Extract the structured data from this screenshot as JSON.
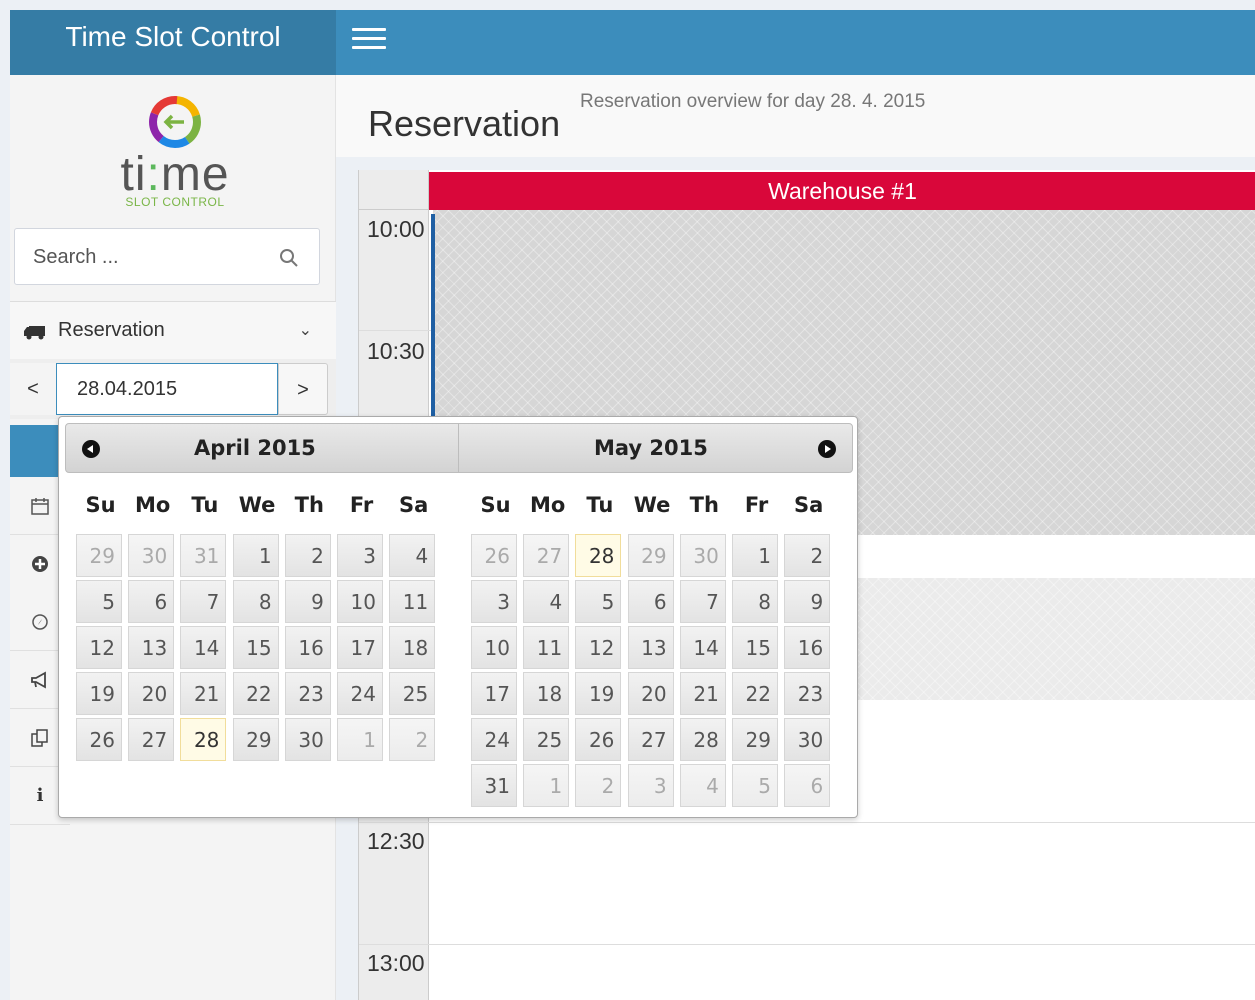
{
  "app": {
    "title": "Time Slot Control"
  },
  "logo": {
    "word_a": "ti",
    "word_b": "me",
    "subtitle": "SLOT CONTROL",
    "ring_colors": [
      "#e53935",
      "#f4b400",
      "#7cb342",
      "#1e88e5",
      "#8e24aa"
    ]
  },
  "search": {
    "placeholder": "Search ..."
  },
  "nav": {
    "reservation_label": "Reservation"
  },
  "date": {
    "prev": "<",
    "next": ">",
    "value": "28.04.2015"
  },
  "sidebar_icons": [
    "calendar-icon",
    "plus-circle-icon",
    "compass-icon",
    "bullhorn-icon",
    "copy-icon",
    "info-icon"
  ],
  "page": {
    "title": "Reservation",
    "subtitle": "Reservation overview for day 28. 4. 2015"
  },
  "schedule": {
    "warehouse": "Warehouse #1",
    "accent_color": "#d9073a",
    "slots": [
      "10:00",
      "10:30",
      "12:30",
      "13:00"
    ]
  },
  "datepicker": {
    "weekdays": [
      "Su",
      "Mo",
      "Tu",
      "We",
      "Th",
      "Fr",
      "Sa"
    ],
    "months": [
      {
        "title": "April 2015",
        "weeks": [
          [
            {
              "d": "29",
              "o": true
            },
            {
              "d": "30",
              "o": true
            },
            {
              "d": "31",
              "o": true
            },
            {
              "d": "1"
            },
            {
              "d": "2"
            },
            {
              "d": "3"
            },
            {
              "d": "4"
            }
          ],
          [
            {
              "d": "5"
            },
            {
              "d": "6"
            },
            {
              "d": "7"
            },
            {
              "d": "8"
            },
            {
              "d": "9"
            },
            {
              "d": "10"
            },
            {
              "d": "11"
            }
          ],
          [
            {
              "d": "12"
            },
            {
              "d": "13"
            },
            {
              "d": "14"
            },
            {
              "d": "15"
            },
            {
              "d": "16"
            },
            {
              "d": "17"
            },
            {
              "d": "18"
            }
          ],
          [
            {
              "d": "19"
            },
            {
              "d": "20"
            },
            {
              "d": "21"
            },
            {
              "d": "22"
            },
            {
              "d": "23"
            },
            {
              "d": "24"
            },
            {
              "d": "25"
            }
          ],
          [
            {
              "d": "26"
            },
            {
              "d": "27"
            },
            {
              "d": "28",
              "t": true
            },
            {
              "d": "29"
            },
            {
              "d": "30"
            },
            {
              "d": "1",
              "o": true
            },
            {
              "d": "2",
              "o": true
            }
          ]
        ]
      },
      {
        "title": "May 2015",
        "weeks": [
          [
            {
              "d": "26",
              "o": true
            },
            {
              "d": "27",
              "o": true
            },
            {
              "d": "28",
              "o": true,
              "t": true
            },
            {
              "d": "29",
              "o": true
            },
            {
              "d": "30",
              "o": true
            },
            {
              "d": "1"
            },
            {
              "d": "2"
            }
          ],
          [
            {
              "d": "3"
            },
            {
              "d": "4"
            },
            {
              "d": "5"
            },
            {
              "d": "6"
            },
            {
              "d": "7"
            },
            {
              "d": "8"
            },
            {
              "d": "9"
            }
          ],
          [
            {
              "d": "10"
            },
            {
              "d": "11"
            },
            {
              "d": "12"
            },
            {
              "d": "13"
            },
            {
              "d": "14"
            },
            {
              "d": "15"
            },
            {
              "d": "16"
            }
          ],
          [
            {
              "d": "17"
            },
            {
              "d": "18"
            },
            {
              "d": "19"
            },
            {
              "d": "20"
            },
            {
              "d": "21"
            },
            {
              "d": "22"
            },
            {
              "d": "23"
            }
          ],
          [
            {
              "d": "24"
            },
            {
              "d": "25"
            },
            {
              "d": "26"
            },
            {
              "d": "27"
            },
            {
              "d": "28"
            },
            {
              "d": "29"
            },
            {
              "d": "30"
            }
          ],
          [
            {
              "d": "31"
            },
            {
              "d": "1",
              "o": true
            },
            {
              "d": "2",
              "o": true
            },
            {
              "d": "3",
              "o": true
            },
            {
              "d": "4",
              "o": true
            },
            {
              "d": "5",
              "o": true
            },
            {
              "d": "6",
              "o": true
            }
          ]
        ]
      }
    ]
  }
}
